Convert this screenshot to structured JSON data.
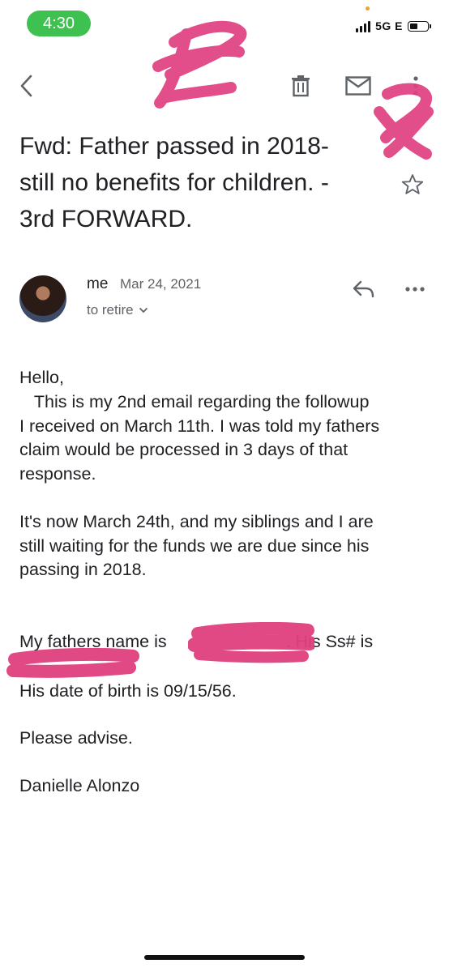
{
  "status_bar": {
    "time": "4:30",
    "network": "5G E"
  },
  "toolbar": {
    "back_icon": "chevron-left-icon",
    "delete_icon": "trash-icon",
    "mark_unread_icon": "mail-icon",
    "more_icon": "more-vertical-icon"
  },
  "email": {
    "subject_lines": [
      "Fwd: Father passed in 2018-",
      "still no benefits for children. -",
      "3rd FORWARD."
    ],
    "sender": "me",
    "date": "Mar 24, 2021",
    "to": "to retire",
    "body": {
      "greeting": "Hello,",
      "p1": "   This is my 2nd email regarding the followup\nI received on March 11th. I was told my fathers\nclaim would be processed in 3 days of that\nresponse.",
      "p2": "It's now March 24th, and my siblings and I are\nstill waiting for the funds we are due since his\npassing in 2018.",
      "p3a": "My fathers name is ",
      "p3b": ". His Ss# is",
      "p4": "His date of birth is 09/15/56.",
      "p5": "Please advise.",
      "signature": "Danielle Alonzo"
    }
  },
  "colors": {
    "status_pill": "#3ec150",
    "redaction": "#e0407f",
    "text": "#202124",
    "secondary": "#5f6368"
  }
}
